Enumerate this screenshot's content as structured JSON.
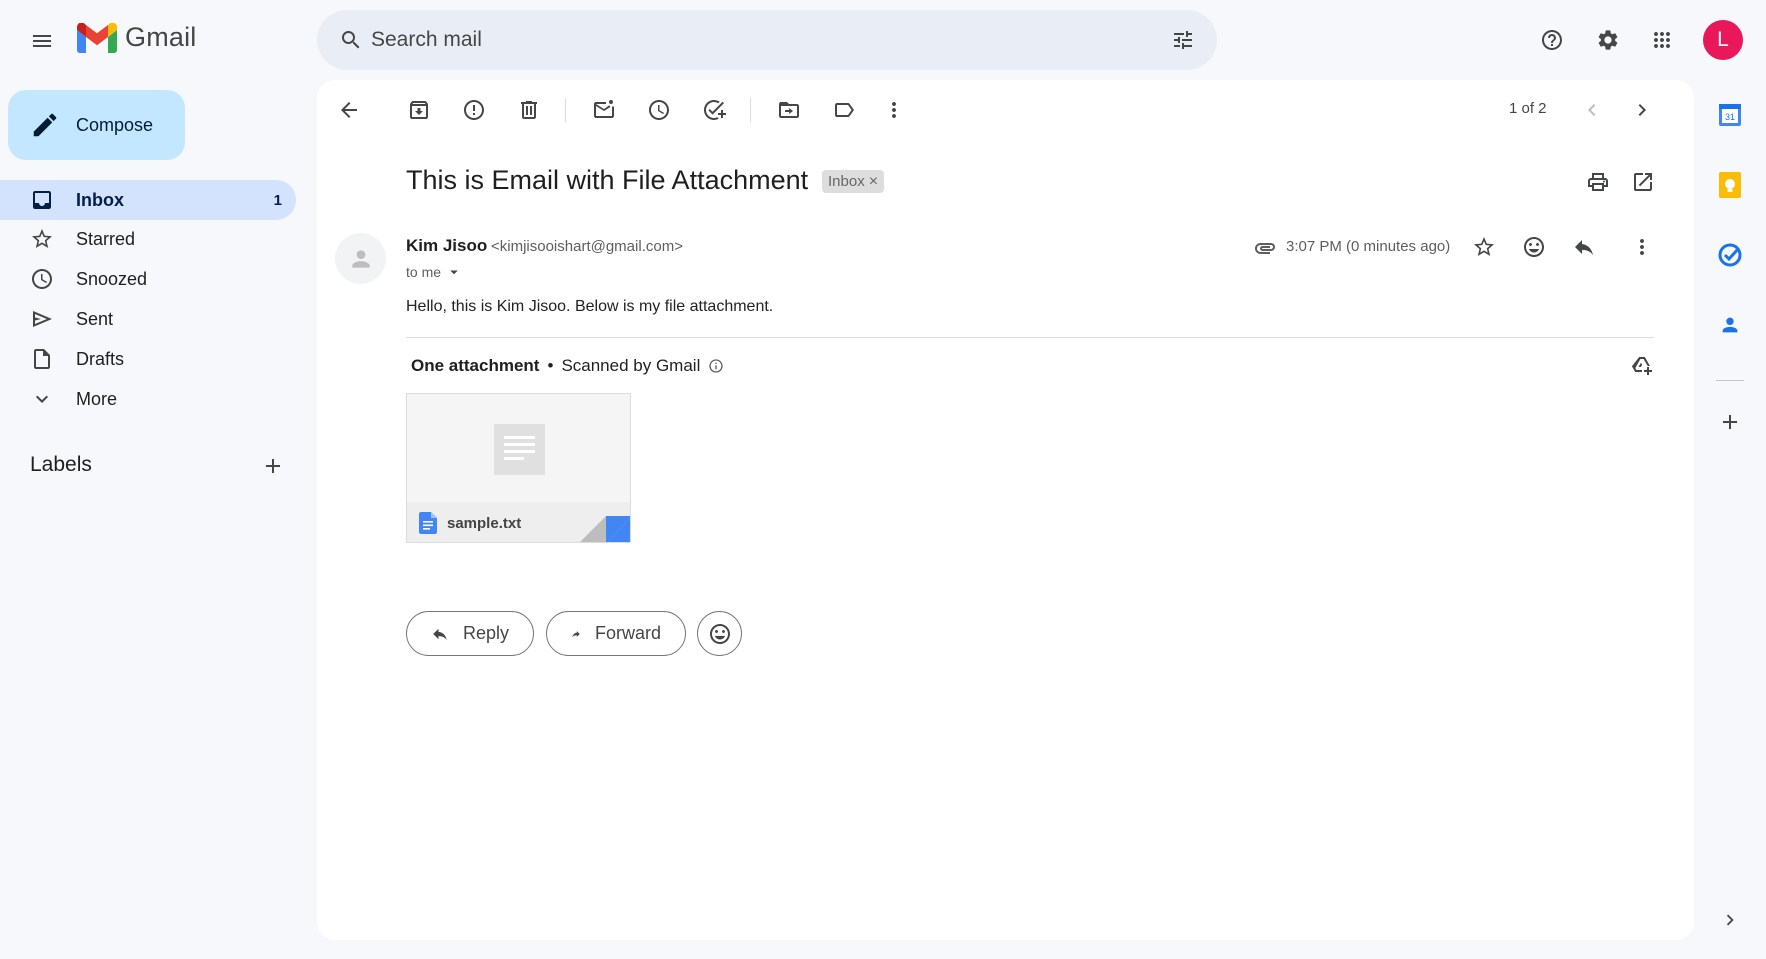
{
  "header": {
    "app_name": "Gmail",
    "search_placeholder": "Search mail",
    "avatar_initial": "L"
  },
  "sidebar": {
    "compose_label": "Compose",
    "items": [
      {
        "label": "Inbox",
        "count": "1",
        "icon": "inbox-icon",
        "active": true
      },
      {
        "label": "Starred",
        "icon": "star-icon"
      },
      {
        "label": "Snoozed",
        "icon": "clock-icon"
      },
      {
        "label": "Sent",
        "icon": "send-icon"
      },
      {
        "label": "Drafts",
        "icon": "draft-icon"
      },
      {
        "label": "More",
        "icon": "chevron-down-icon"
      }
    ],
    "labels_title": "Labels"
  },
  "toolbar": {
    "pager": "1 of 2"
  },
  "email": {
    "subject": "This is Email with File Attachment",
    "label_chip": "Inbox",
    "label_chip_close": "×",
    "sender_name": "Kim Jisoo",
    "sender_email": "<kimjisooishart@gmail.com>",
    "recipient": "to me",
    "time": "3:07 PM (0 minutes ago)",
    "body": "Hello, this is Kim Jisoo. Below is my file attachment.",
    "attachments_heading": "One attachment",
    "attachments_sep": "•",
    "scanned_text": "Scanned by Gmail",
    "attachment": {
      "filename": "sample.txt"
    }
  },
  "actions": {
    "reply": "Reply",
    "forward": "Forward"
  },
  "colors": {
    "background": "#f6f8fc",
    "compose": "#c2e7ff",
    "active_nav": "#d3e3fd",
    "avatar": "#e8185a"
  }
}
